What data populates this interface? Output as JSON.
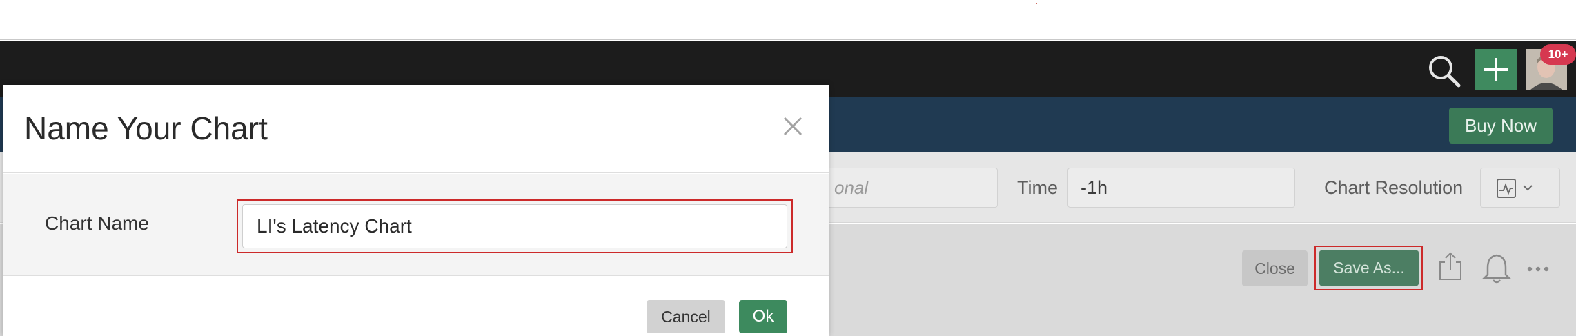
{
  "navbar": {
    "search_icon": "search-icon",
    "add_icon": "plus-icon",
    "notification_badge": "10+",
    "colors": {
      "bar": "#1c1c1c",
      "add": "#3f8a5f",
      "badge": "#d63850"
    }
  },
  "subheader": {
    "buy_now_label": "Buy Now",
    "colors": {
      "bar": "#203a52",
      "buy_now": "#3b7a57"
    }
  },
  "filters": {
    "optional_placeholder": "onal",
    "time_label": "Time",
    "time_value": "-1h",
    "chart_resolution_label": "Chart Resolution",
    "resolution_icon": "pulse-icon"
  },
  "toolbar": {
    "close_label": "Close",
    "save_as_label": "Save As...",
    "share_icon": "share-icon",
    "alert_icon": "bell-icon",
    "more_icon": "more-icon"
  },
  "modal": {
    "title": "Name Your Chart",
    "close_icon": "close-icon",
    "chart_name_label": "Chart Name",
    "chart_name_value": "LI's Latency Chart",
    "cancel_label": "Cancel",
    "ok_label": "Ok",
    "colors": {
      "ok": "#3d8a5e",
      "highlight": "#cc2a2a"
    }
  }
}
